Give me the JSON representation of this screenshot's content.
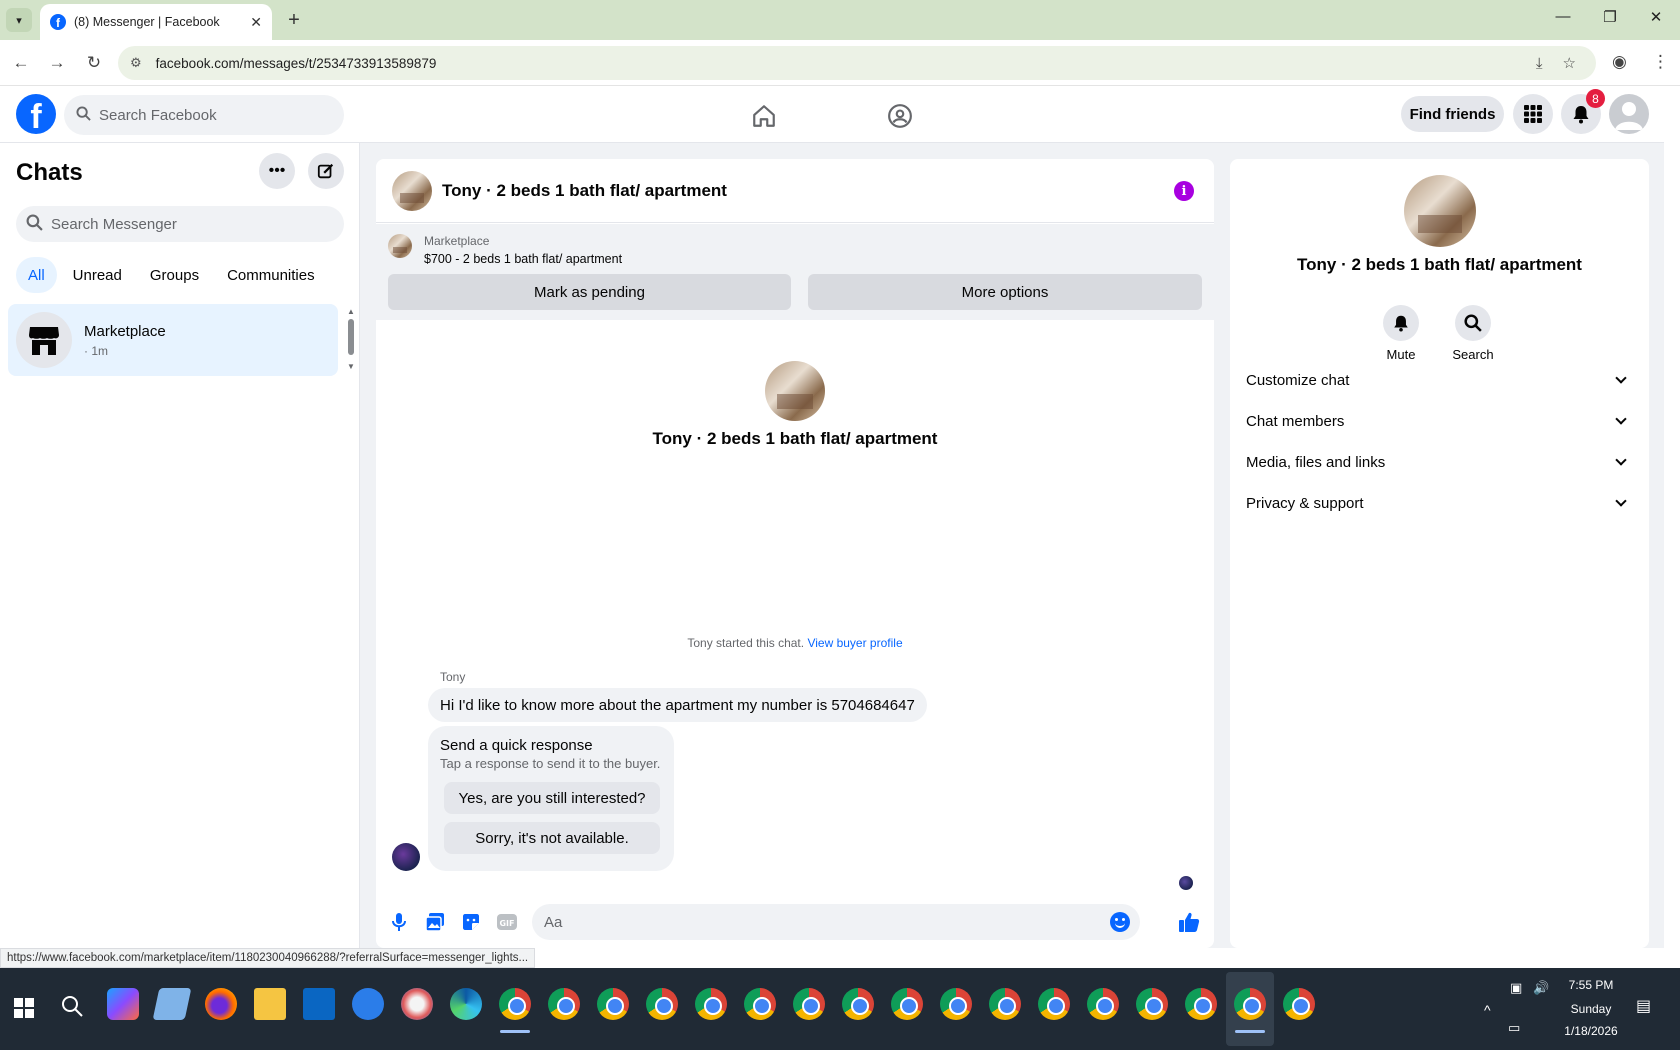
{
  "browser": {
    "tab_title": "(8) Messenger | Facebook",
    "url": "facebook.com/messages/t/2534733913589879",
    "status_url": "https://www.facebook.com/marketplace/item/1180230040966288/?referralSurface=messenger_lights..."
  },
  "topbar": {
    "search_placeholder": "Search Facebook",
    "find_friends": "Find friends",
    "notification_count": "8"
  },
  "chats": {
    "title": "Chats",
    "search_placeholder": "Search Messenger",
    "filters": [
      "All",
      "Unread",
      "Groups",
      "Communities"
    ],
    "active_filter": "All",
    "items": [
      {
        "name": "Marketplace",
        "sub": "· 1m"
      }
    ]
  },
  "conversation": {
    "title": "Tony · 2 beds 1 bath flat/ apartment",
    "marketplace_label": "Marketplace",
    "listing": "$700 - 2 beds 1 bath flat/ apartment",
    "mark_pending": "Mark as pending",
    "more_options": "More options",
    "intro_name": "Tony · 2 beds 1 bath flat/ apartment",
    "started_text": "Tony started this chat.",
    "buyer_profile_link": "View buyer profile",
    "sender": "Tony",
    "message": "Hi I'd like to know more about the apartment my number is 5704684647",
    "quick_response": {
      "title": "Send a quick response",
      "subtitle": "Tap a response to send it to the buyer.",
      "options": [
        "Yes, are you still interested?",
        "Sorry, it's not available."
      ]
    },
    "composer_placeholder": "Aa"
  },
  "info_panel": {
    "name": "Tony · 2 beds 1 bath flat/ apartment",
    "actions": [
      "Mute",
      "Search"
    ],
    "sections": [
      "Customize chat",
      "Chat members",
      "Media, files and links",
      "Privacy & support"
    ]
  },
  "taskbar": {
    "time": "7:55 PM",
    "day": "Sunday",
    "date": "1/18/2026"
  },
  "colors": {
    "accent": "#0866ff",
    "selected_bg": "#e7f3ff",
    "info_icon": "#a800e0",
    "badge": "#e41e3f"
  }
}
